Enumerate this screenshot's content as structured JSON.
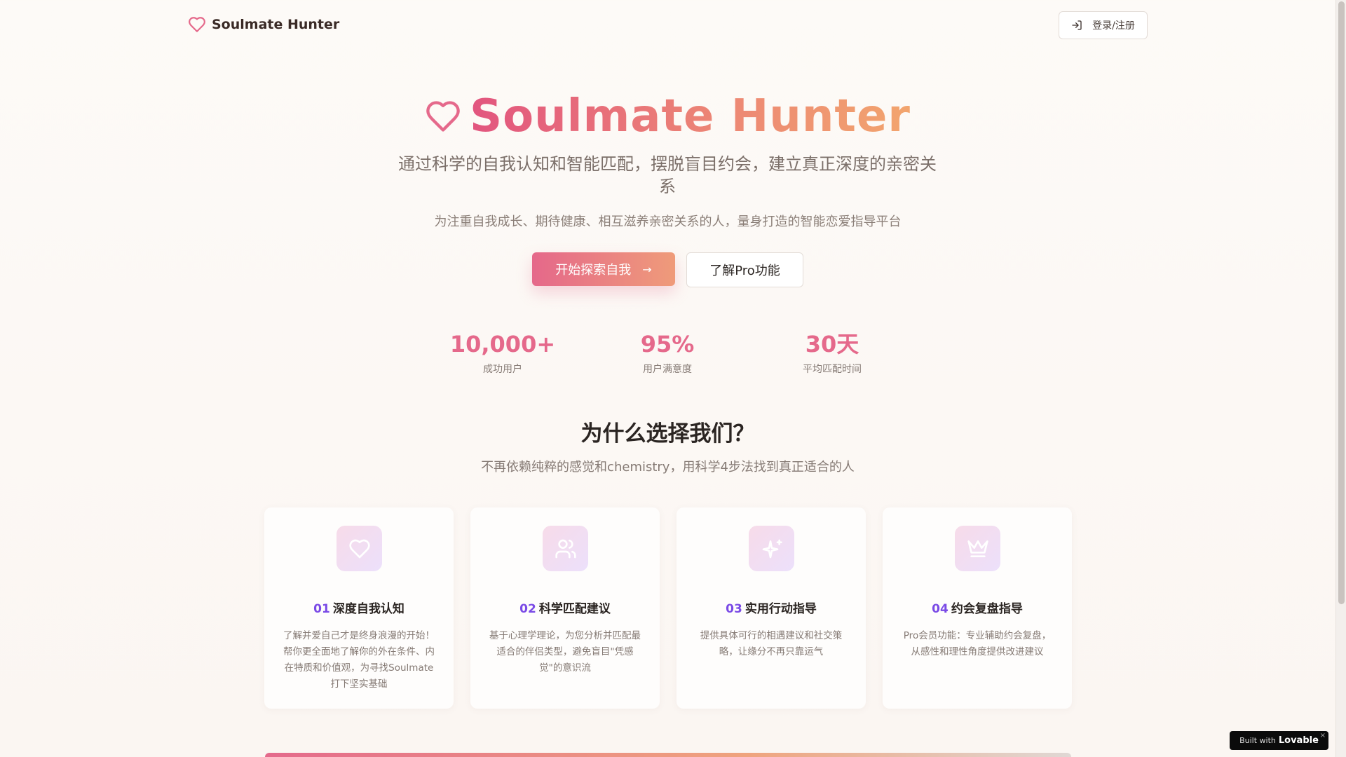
{
  "header": {
    "brand_name": "Soulmate Hunter",
    "login_label": "登录/注册"
  },
  "hero": {
    "title": "Soulmate Hunter",
    "subtitle": "通过科学的自我认知和智能匹配，摆脱盲目约会，建立真正深度的亲密关系",
    "description": "为注重自我成长、期待健康、相互滋养亲密关系的人，量身打造的智能恋爱指导平台",
    "primary_cta": "开始探索自我",
    "secondary_cta": "了解Pro功能"
  },
  "stats": [
    {
      "value": "10,000+",
      "label": "成功用户"
    },
    {
      "value": "95%",
      "label": "用户满意度"
    },
    {
      "value": "30天",
      "label": "平均匹配时间"
    }
  ],
  "why": {
    "title": "为什么选择我们？",
    "subtitle": "不再依赖纯粹的感觉和chemistry，用科学4步法找到真正适合的人",
    "cards": [
      {
        "no": "01",
        "title": "深度自我认知",
        "desc": "了解并爱自己才是终身浪漫的开始！ 帮你更全面地了解你的外在条件、内在特质和价值观，为寻找Soulmate打下坚实基础",
        "icon": "heart-icon"
      },
      {
        "no": "02",
        "title": "科学匹配建议",
        "desc": "基于心理学理论，为您分析并匹配最适合的伴侣类型，避免盲目\"凭感觉\"的意识流",
        "icon": "users-icon"
      },
      {
        "no": "03",
        "title": "实用行动指导",
        "desc": "提供具体可行的相遇建议和社交策略，让缘分不再只靠运气",
        "icon": "sparkles-icon"
      },
      {
        "no": "04",
        "title": "约会复盘指导",
        "desc": "Pro会员功能：专业辅助约会复盘，从感性和理性角度提供改进建议",
        "icon": "crown-icon"
      }
    ]
  },
  "badge": {
    "built_with": "Built with",
    "brand": "Lovable",
    "close": "×"
  },
  "colors": {
    "accent_pink": "#e5698b",
    "accent_orange": "#f2a56e",
    "number_purple": "#7a4ae6"
  }
}
